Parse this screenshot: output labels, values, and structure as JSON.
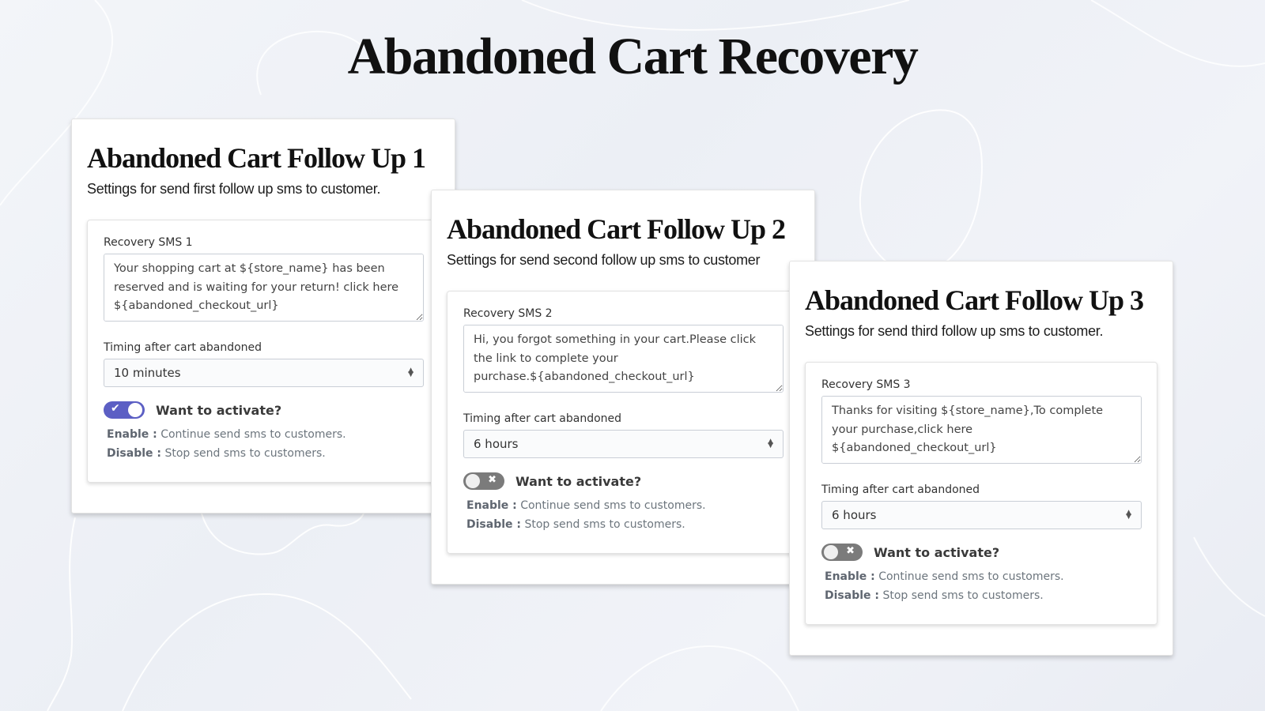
{
  "page": {
    "title": "Abandoned Cart Recovery"
  },
  "cards": [
    {
      "title": "Abandoned Cart Follow Up 1",
      "subtitle": "Settings for send first follow up sms to customer.",
      "sms_label": "Recovery SMS 1",
      "sms_text": "Your shopping cart at ${store_name} has been reserved and is waiting for your return! click here ${abandoned_checkout_url}",
      "timing_label": "Timing after cart abandoned",
      "timing_value": "10 minutes",
      "toggle_state": "on",
      "toggle_glyph": "✔",
      "toggle_label": "Want to activate?",
      "enable_label": "Enable  :",
      "enable_text": " Continue send sms to customers.",
      "disable_label": "Disable :",
      "disable_text": " Stop send sms to customers."
    },
    {
      "title": "Abandoned Cart Follow Up 2",
      "subtitle": "Settings for send second follow up sms to customer",
      "sms_label": "Recovery SMS 2",
      "sms_text": "Hi, you forgot something in your cart.Please click the link to complete your purchase.${abandoned_checkout_url}",
      "timing_label": "Timing after cart abandoned",
      "timing_value": "6 hours",
      "toggle_state": "off",
      "toggle_glyph": "✖",
      "toggle_label": "Want to activate?",
      "enable_label": "Enable  :",
      "enable_text": " Continue send sms to customers.",
      "disable_label": "Disable :",
      "disable_text": " Stop send sms to customers."
    },
    {
      "title": "Abandoned Cart Follow Up 3",
      "subtitle": "Settings for send third follow up sms to customer.",
      "sms_label": "Recovery SMS 3",
      "sms_text": "Thanks for visiting ${store_name},To complete your purchase,click here ${abandoned_checkout_url}",
      "timing_label": "Timing after cart abandoned",
      "timing_value": "6 hours",
      "toggle_state": "off",
      "toggle_glyph": "✖",
      "toggle_label": "Want to activate?",
      "enable_label": "Enable  :",
      "enable_text": " Continue send sms to customers.",
      "disable_label": "Disable :",
      "disable_text": " Stop send sms to customers."
    }
  ],
  "colors": {
    "toggle_on": "#5c5fc4",
    "toggle_off": "#7b7b7b"
  }
}
